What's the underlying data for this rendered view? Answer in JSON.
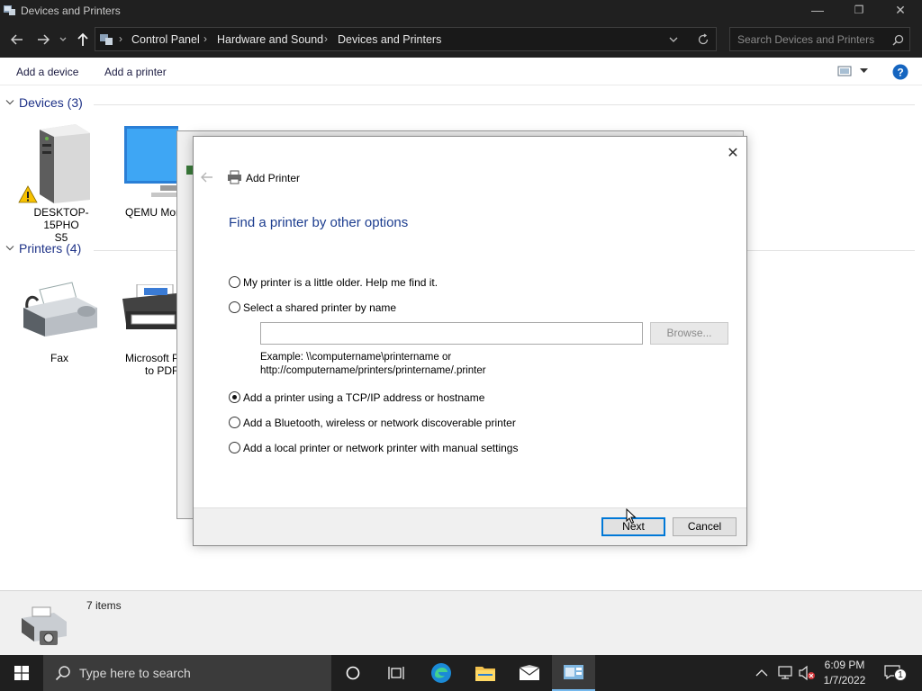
{
  "window": {
    "title": "Devices and Printers",
    "controls": {
      "minimize": "—",
      "restore": "❐",
      "close": "✕"
    }
  },
  "address": {
    "breadcrumb": [
      "Control Panel",
      "Hardware and Sound",
      "Devices and Printers"
    ],
    "search_placeholder": "Search Devices and Printers"
  },
  "commands": {
    "add_device": "Add a device",
    "add_printer": "Add a printer"
  },
  "groups": {
    "devices": {
      "label": "Devices (3)",
      "items": [
        {
          "label_line1": "DESKTOP-15PHO",
          "label_line2": "S5"
        },
        {
          "label_line1": "QEMU Mon",
          "label_line2": ""
        }
      ]
    },
    "printers": {
      "label": "Printers (4)",
      "items": [
        {
          "label_line1": "Fax",
          "label_line2": ""
        },
        {
          "label_line1": "Microsoft P",
          "label_line2": "to PDF"
        }
      ]
    }
  },
  "dialog": {
    "title": "Add Printer",
    "heading": "Find a printer by other options",
    "close": "✕",
    "options": [
      {
        "label": "My printer is a little older. Help me find it.",
        "selected": false
      },
      {
        "label": "Select a shared printer by name",
        "selected": false
      },
      {
        "label": "Add a printer using a TCP/IP address or hostname",
        "selected": true
      },
      {
        "label": "Add a Bluetooth, wireless or network discoverable printer",
        "selected": false
      },
      {
        "label": "Add a local printer or network printer with manual settings",
        "selected": false
      }
    ],
    "shared_name_value": "",
    "browse_label": "Browse...",
    "example_line1": "Example: \\\\computername\\printername or",
    "example_line2": "http://computername/printers/printername/.printer",
    "next_label": "Next",
    "cancel_label": "Cancel"
  },
  "status": {
    "item_count": "7 items"
  },
  "taskbar": {
    "search_placeholder": "Type here to search",
    "time": "6:09 PM",
    "date": "1/7/2022",
    "notification_count": "1"
  }
}
